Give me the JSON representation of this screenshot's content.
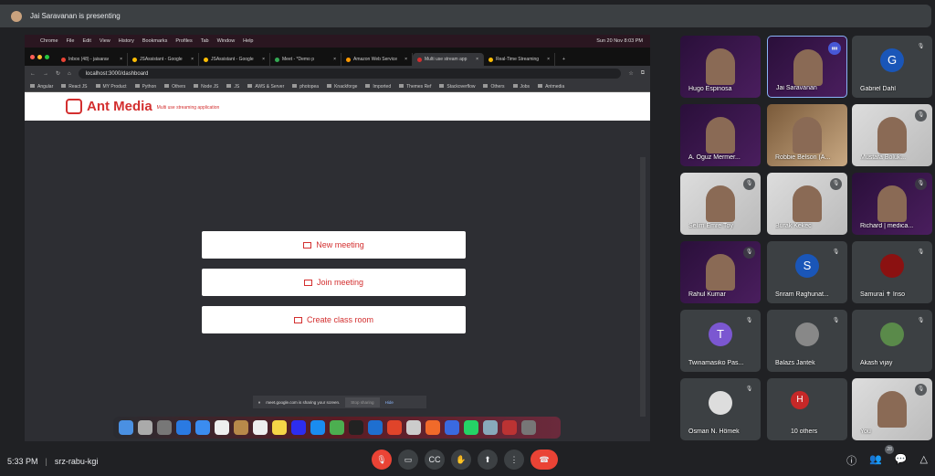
{
  "presenter": "Jai Saravanan is presenting",
  "mac_menu": {
    "apple": "",
    "items": [
      "Chrome",
      "File",
      "Edit",
      "View",
      "History",
      "Bookmarks",
      "Profiles",
      "Tab",
      "Window",
      "Help"
    ],
    "datetime": "Sun 20 Nov 8:03 PM"
  },
  "tabs": [
    {
      "label": "Inbox (48) - jaisarav",
      "color": "#ea4335"
    },
    {
      "label": "JSAssistant - Google",
      "color": "#fbbc04"
    },
    {
      "label": "JSAssistant - Google",
      "color": "#fbbc04"
    },
    {
      "label": "Meet - *Demo p",
      "color": "#34a853"
    },
    {
      "label": "Amazon Web Service",
      "color": "#ff9900"
    },
    {
      "label": "Multi use stream app",
      "color": "#d32f2f",
      "active": true
    },
    {
      "label": "Real-Time Streaming",
      "color": "#fbbc04"
    }
  ],
  "url": "localhost:3000/dashboard",
  "bookmarks": [
    "Angular",
    "React JS",
    "MY Product",
    "Python",
    "Others",
    "Node JS",
    "JS",
    "AWS & Server",
    "photopea",
    "Knackforge",
    "Imported",
    "Themes Ref",
    "Stackoverflow",
    "Others",
    "Jobs",
    "Antmedia"
  ],
  "app": {
    "brand": "Ant Media",
    "tagline": "Multi use streaming application",
    "buttons": [
      "New meeting",
      "Join meeting",
      "Create class room"
    ]
  },
  "share_bar": {
    "text": "meet.google.com is sharing your screen.",
    "stop": "Stop sharing",
    "hide": "Hide"
  },
  "dock_colors": [
    "#4a90e2",
    "#aaa",
    "#777",
    "#2a7ae2",
    "#3b8cf0",
    "#eee",
    "#b8894a",
    "#eee",
    "#f5d547",
    "#2d2df0",
    "#1a8cf0",
    "#4caf50",
    "#222",
    "#1e6fd0",
    "#e0442a",
    "#ccc",
    "#f06a2a",
    "#3a6ae0",
    "#25d366",
    "#8ab",
    "#b33",
    "#777"
  ],
  "participants": [
    {
      "name": "Hugo Espinosa",
      "type": "video",
      "muted": false
    },
    {
      "name": "Jai Saravanan",
      "type": "video",
      "speaking": true
    },
    {
      "name": "Gabriel Dahl",
      "type": "avatar",
      "initial": "G",
      "color": "#1a56b8",
      "muted": true
    },
    {
      "name": "A. Oguz Mermer...",
      "type": "video",
      "muted": false
    },
    {
      "name": "Robbie Belson (A...",
      "type": "room",
      "muted": false
    },
    {
      "name": "Mustafa Boluk...",
      "type": "light",
      "muted": true
    },
    {
      "name": "Selim Emre Toy",
      "type": "light",
      "muted": true
    },
    {
      "name": "Burak Kekec",
      "type": "light",
      "muted": true
    },
    {
      "name": "Richard | medica...",
      "type": "video",
      "muted": true
    },
    {
      "name": "Rahul Kumar",
      "type": "video",
      "muted": true
    },
    {
      "name": "Sriram Raghunat...",
      "type": "avatar",
      "initial": "S",
      "color": "#1a56b8",
      "muted": true
    },
    {
      "name": "Samurai ✝ Inso",
      "type": "avatar",
      "initial": "",
      "color": "#8b1111",
      "muted": true
    },
    {
      "name": "Twinamasiko Pas...",
      "type": "avatar",
      "initial": "T",
      "color": "#7b57d1",
      "muted": true
    },
    {
      "name": "Balazs Jantek",
      "type": "avatar",
      "initial": "",
      "color": "#888",
      "muted": true
    },
    {
      "name": "Akash vijay",
      "type": "avatar",
      "initial": "",
      "color": "#5a8a4a",
      "muted": true
    },
    {
      "name": "Osman N. Hömek",
      "type": "avatar",
      "initial": "",
      "color": "#ddd",
      "muted": true
    },
    {
      "name": "10 others",
      "type": "others",
      "initial": "H",
      "color": "#c62828",
      "muted": false
    },
    {
      "name": "You",
      "type": "light",
      "muted": true
    }
  ],
  "bottom": {
    "time": "5:33 PM",
    "meeting_code": "srz-rabu-kgi",
    "participant_count": "28"
  }
}
